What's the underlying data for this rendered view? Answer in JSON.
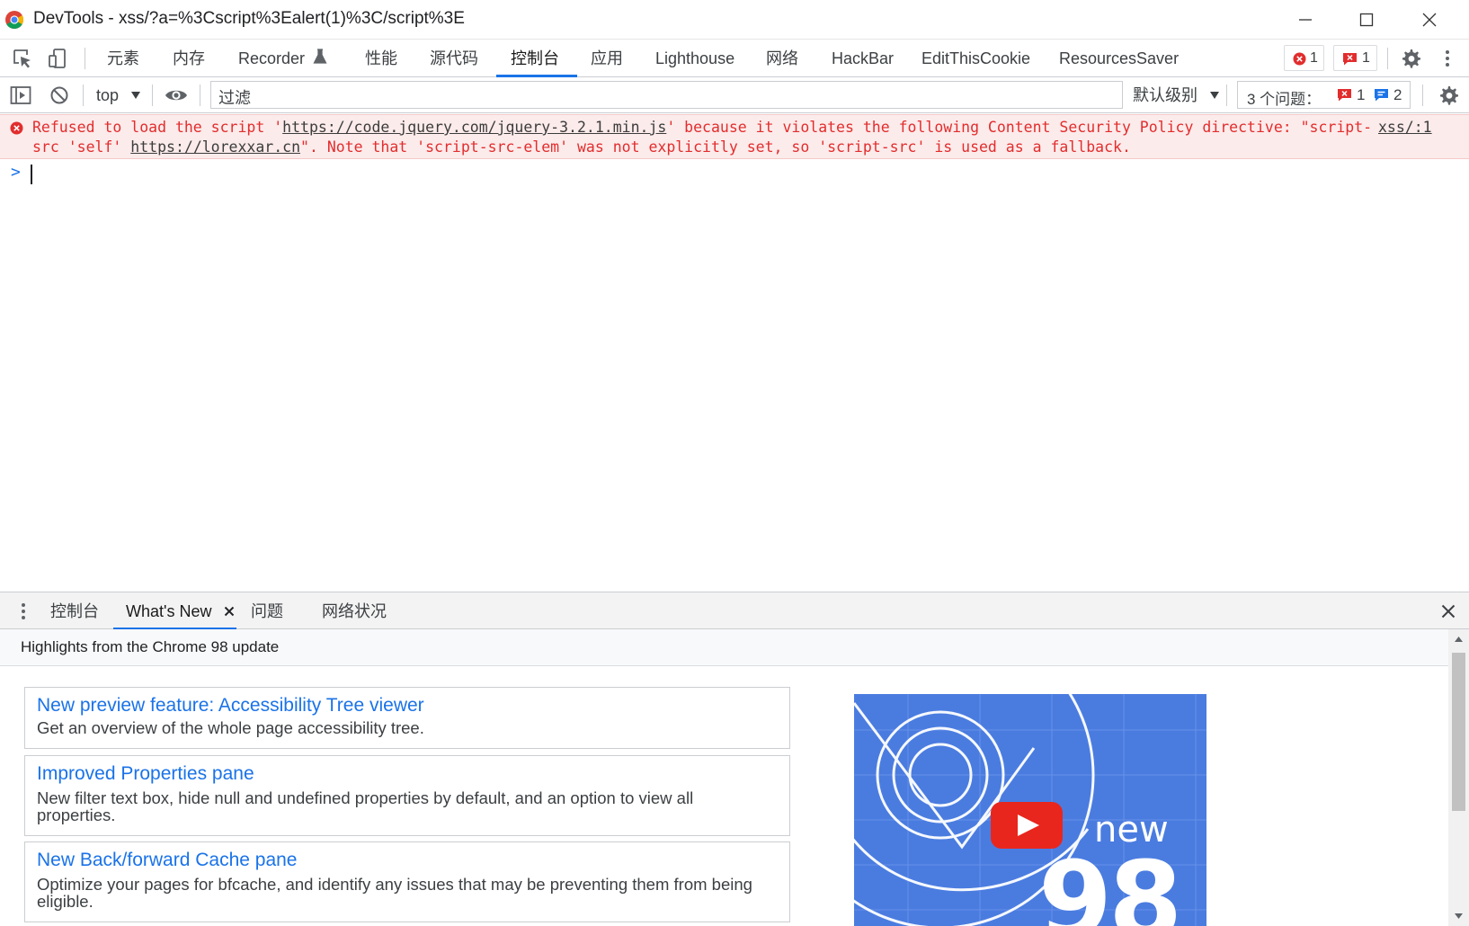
{
  "window": {
    "title": "DevTools - xss/?a=%3Cscript%3Ealert(1)%3C/script%3E",
    "minimize_icon": "minimize-icon",
    "maximize_icon": "maximize-icon",
    "close_icon": "close-icon"
  },
  "main_tabs": [
    {
      "label": "元素"
    },
    {
      "label": "内存"
    },
    {
      "label": "Recorder",
      "icon": "flask-icon"
    },
    {
      "label": "性能"
    },
    {
      "label": "源代码"
    },
    {
      "label": "控制台",
      "active": true
    },
    {
      "label": "应用"
    },
    {
      "label": "Lighthouse"
    },
    {
      "label": "网络"
    },
    {
      "label": "HackBar"
    },
    {
      "label": "EditThisCookie"
    },
    {
      "label": "ResourcesSaver"
    }
  ],
  "counters": {
    "errors": "1",
    "issues": "1"
  },
  "console_toolbar": {
    "context": "top",
    "filter_placeholder": "过滤",
    "levels": "默认级别",
    "issues_label": "3 个问题：",
    "issues_errors": "1",
    "issues_info": "2"
  },
  "console_messages": [
    {
      "type": "error",
      "line1_pre": "Refused to load the script '",
      "line1_link": "https://code.jquery.com/jquery-3.2.1.min.js",
      "line1_post": "' because it violates the following Content Security Policy directive: \"script-",
      "line2_pre": "src 'self' ",
      "line2_link": "https://lorexxar.cn",
      "line2_post": "\". Note that 'script-src-elem' was not explicitly set, so 'script-src' is used as a fallback.",
      "source": "xss/:1"
    }
  ],
  "prompt_symbol": ">",
  "drawer": {
    "tabs": [
      {
        "label": "控制台"
      },
      {
        "label": "What's New",
        "active": true,
        "closable": true
      },
      {
        "label": "问题"
      },
      {
        "label": "网络状况"
      }
    ],
    "close_icon": "close-icon",
    "highlights": "Highlights from the Chrome 98 update",
    "cards": [
      {
        "title": "New preview feature: Accessibility Tree viewer",
        "desc": "Get an overview of the whole page accessibility tree."
      },
      {
        "title": "Improved Properties pane",
        "desc": "New filter text box, hide null and undefined properties by default, and an option to view all properties."
      },
      {
        "title": "New Back/forward Cache pane",
        "desc": "Optimize your pages for bfcache, and identify any issues that may be preventing them from being eligible."
      }
    ],
    "thumbnail": {
      "label": "new",
      "number": "98",
      "icon": "youtube-play-icon"
    }
  },
  "colors": {
    "accent": "#1a73e8",
    "error_text": "#e22d2d",
    "error_bg": "#fcebeb",
    "thumb_bg": "#4a7ce0",
    "youtube_red": "#e8261d"
  }
}
